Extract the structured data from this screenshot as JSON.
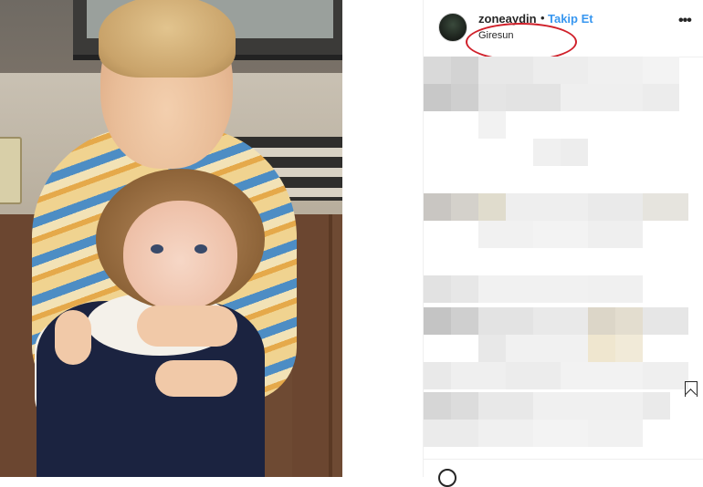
{
  "post": {
    "username": "zoneaydin",
    "separator": "•",
    "follow_label": "Takip Et",
    "location": "Giresun"
  },
  "icons": {
    "more": "more-options-icon",
    "bookmark": "bookmark-icon",
    "emoji": "emoji-icon"
  },
  "colors": {
    "follow": "#3897f0",
    "highlight_ring": "#d0202a"
  }
}
